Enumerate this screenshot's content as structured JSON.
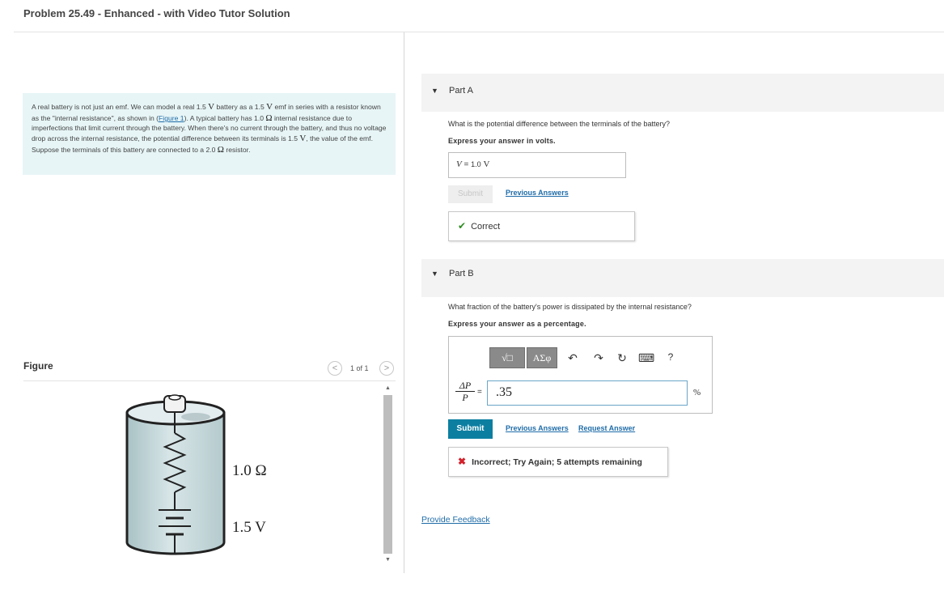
{
  "page": {
    "title": "Problem 25.49 - Enhanced - with Video Tutor Solution"
  },
  "problem": {
    "seg1": "A real battery is not just an emf. We can model a real 1.5 ",
    "v1": "V",
    "seg2": " battery as a 1.5 ",
    "v2": "V",
    "seg3": " emf in series with a resistor known as the \"internal resistance\", as shown in (",
    "figure_link": "Figure 1",
    "seg4": "). A typical battery has 1.0 ",
    "ohm1": "Ω",
    "seg5": " internal resistance due to imperfections that limit current through the battery. When there's no current through the battery, and thus no voltage drop across the internal resistance, the potential difference between its terminals is 1.5 ",
    "v3": "V",
    "seg6": ", the value of the emf.  Suppose the terminals of this battery are connected to a 2.0 ",
    "ohm2": "Ω",
    "seg7": " resistor."
  },
  "figure": {
    "label": "Figure",
    "prev_icon": "<",
    "next_icon": ">",
    "count": "1 of 1",
    "resistance_label": "1.0 Ω",
    "emf_label": "1.5 V"
  },
  "partA": {
    "title": "Part A",
    "question": "What is the potential difference between the terminals of the battery?",
    "express": "Express your answer in volts.",
    "answer_var": "V",
    "answer_eq": "=",
    "answer_value": "1.0",
    "answer_unit": "V",
    "submit_label": "Submit",
    "previous_answers": "Previous Answers",
    "feedback_icon": "✔",
    "feedback": "Correct"
  },
  "partB": {
    "title": "Part B",
    "question": "What fraction of the battery's power is dissipated by the internal resistance?",
    "express": "Express your answer as a percentage.",
    "toolbar": {
      "templates_label": "√□",
      "symbols_label": "ΑΣφ",
      "undo_icon": "↶",
      "redo_icon": "↷",
      "reset_icon": "↻",
      "keyboard_icon": "⌨",
      "help_icon": "?"
    },
    "fraction_num": "ΔP",
    "fraction_den": "P",
    "equals": "=",
    "input_value": ".35",
    "unit": "%",
    "submit_label": "Submit",
    "previous_answers": "Previous Answers",
    "request_answer": "Request Answer",
    "feedback_icon": "✖",
    "feedback": "Incorrect; Try Again; 5 attempts remaining"
  },
  "footer": {
    "provide_feedback": "Provide Feedback"
  },
  "colors": {
    "accent": "#0c7fa1",
    "link": "#1f6ca8",
    "correct": "#2e8b1f",
    "incorrect": "#d3202a",
    "problem_bg": "#e7f5f6"
  }
}
